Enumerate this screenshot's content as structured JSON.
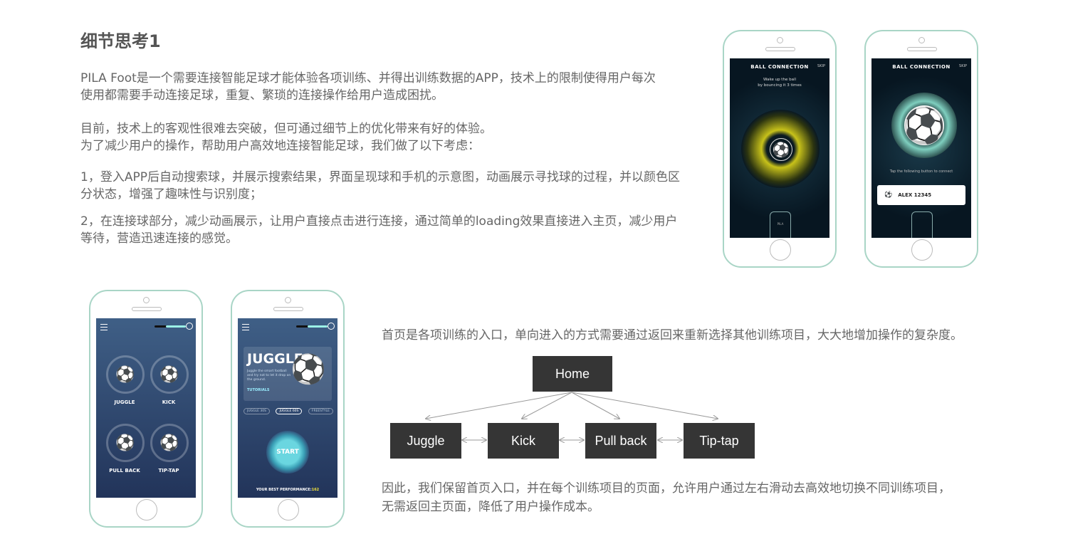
{
  "title": "细节思考1",
  "paragraphs": {
    "p1_line1": "PILA Foot是一个需要连接智能足球才能体验各项训练、并得出训练数据的APP，技术上的限制使得用户每次",
    "p1_line2": "使用都需要手动连接足球，重复、繁琐的连接操作给用户造成困扰。",
    "p2_line1": "目前，技术上的客观性很难去突破，但可通过细节上的优化带来有好的体验。",
    "p2_line2": "为了减少用户的操作，帮助用户高效地连接智能足球，我们做了以下考虑：",
    "p3_line1": "1，登入APP后自动搜索球，并展示搜索结果，界面呈现球和手机的示意图，动画展示寻找球的过程，并以颜色区",
    "p3_line2": "分状态，增强了趣味性与识别度；",
    "p4_line1": "2，在连接球部分，减少动画展示，让用户直接点击进行连接，通过简单的loading效果直接进入主页，减少用户",
    "p4_line2": "等待，营造迅速连接的感觉。"
  },
  "phone1": {
    "title": "BALL CONNECTION",
    "skip": "SKIP",
    "subtitle_line1": "Wake up the ball",
    "subtitle_line2": "by bouncing it 3 times",
    "mini_label": "PILA"
  },
  "phone2": {
    "title": "BALL CONNECTION",
    "skip": "SKIP",
    "tap_text": "Tap the following button to connect",
    "device": "ALEX 12345"
  },
  "phone3": {
    "tiles": [
      "JUGGLE",
      "KICK",
      "PULL BACK",
      "TIP-TAP"
    ]
  },
  "phone4": {
    "card_title": "JUGGLE",
    "card_desc": "Juggle the smart football and try not to let it drop on the ground.",
    "tutorials": "TUTORIALS",
    "tabs": [
      "JUGGLE 30S",
      "JUGGLE 60S",
      "FREESTYLE"
    ],
    "start": "START",
    "best_label": "YOUR BEST PERFORMANCE:",
    "best_value": "162"
  },
  "desc_top": "首页是各项训练的入口，单向进入的方式需要通过返回来重新选择其他训练项目，大大地增加操作的复杂度。",
  "tree": {
    "root": "Home",
    "children": [
      "Juggle",
      "Kick",
      "Pull back",
      "Tip-tap"
    ]
  },
  "desc_bottom_line1": "因此，我们保留首页入口，并在每个训练项目的页面，允许用户通过左右滑动去高效地切换不同训练项目，",
  "desc_bottom_line2": "无需返回主页面，降低了用户操作成本。",
  "colors": {
    "phone_border": "#a9d5c6",
    "node_bg": "#353535",
    "glow_yellow": "#c8c21a",
    "glow_green": "#7fcfbf"
  }
}
